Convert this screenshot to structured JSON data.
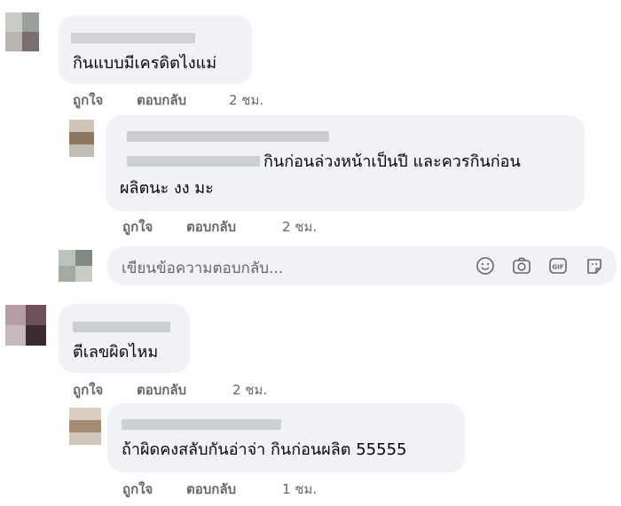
{
  "comments": [
    {
      "text_lines": [
        "กินแบบมีเครดิตไงแม่"
      ],
      "actions": {
        "like": "ถูกใจ",
        "reply": "ตอบกลับ",
        "time": "2 ชม."
      }
    },
    {
      "text_lines": [
        "กินก่อนล่วงหน้าเป็นปี และควรกินก่อน",
        "ผลิตนะ งง มะ"
      ],
      "actions": {
        "like": "ถูกใจ",
        "reply": "ตอบกลับ",
        "time": "2 ชม."
      }
    },
    {
      "text_lines": [
        "ตีเลขผิดไหม"
      ],
      "actions": {
        "like": "ถูกใจ",
        "reply": "ตอบกลับ",
        "time": "2 ชม."
      }
    },
    {
      "text_lines": [
        "ถ้าผิดคงสลับกันอ่าจ่า กินก่อนผลิต 55555"
      ],
      "actions": {
        "like": "ถูกใจ",
        "reply": "ตอบกลับ",
        "time": "1 ชม."
      }
    }
  ],
  "reply_input": {
    "placeholder": "เขียนข้อความตอบกลับ...",
    "icons": [
      "smile-icon",
      "camera-icon",
      "gif-icon",
      "sticker-icon"
    ]
  },
  "colors": {
    "bubble": "#f0f2f5",
    "action_text": "#65676b",
    "body_text": "#050505"
  }
}
